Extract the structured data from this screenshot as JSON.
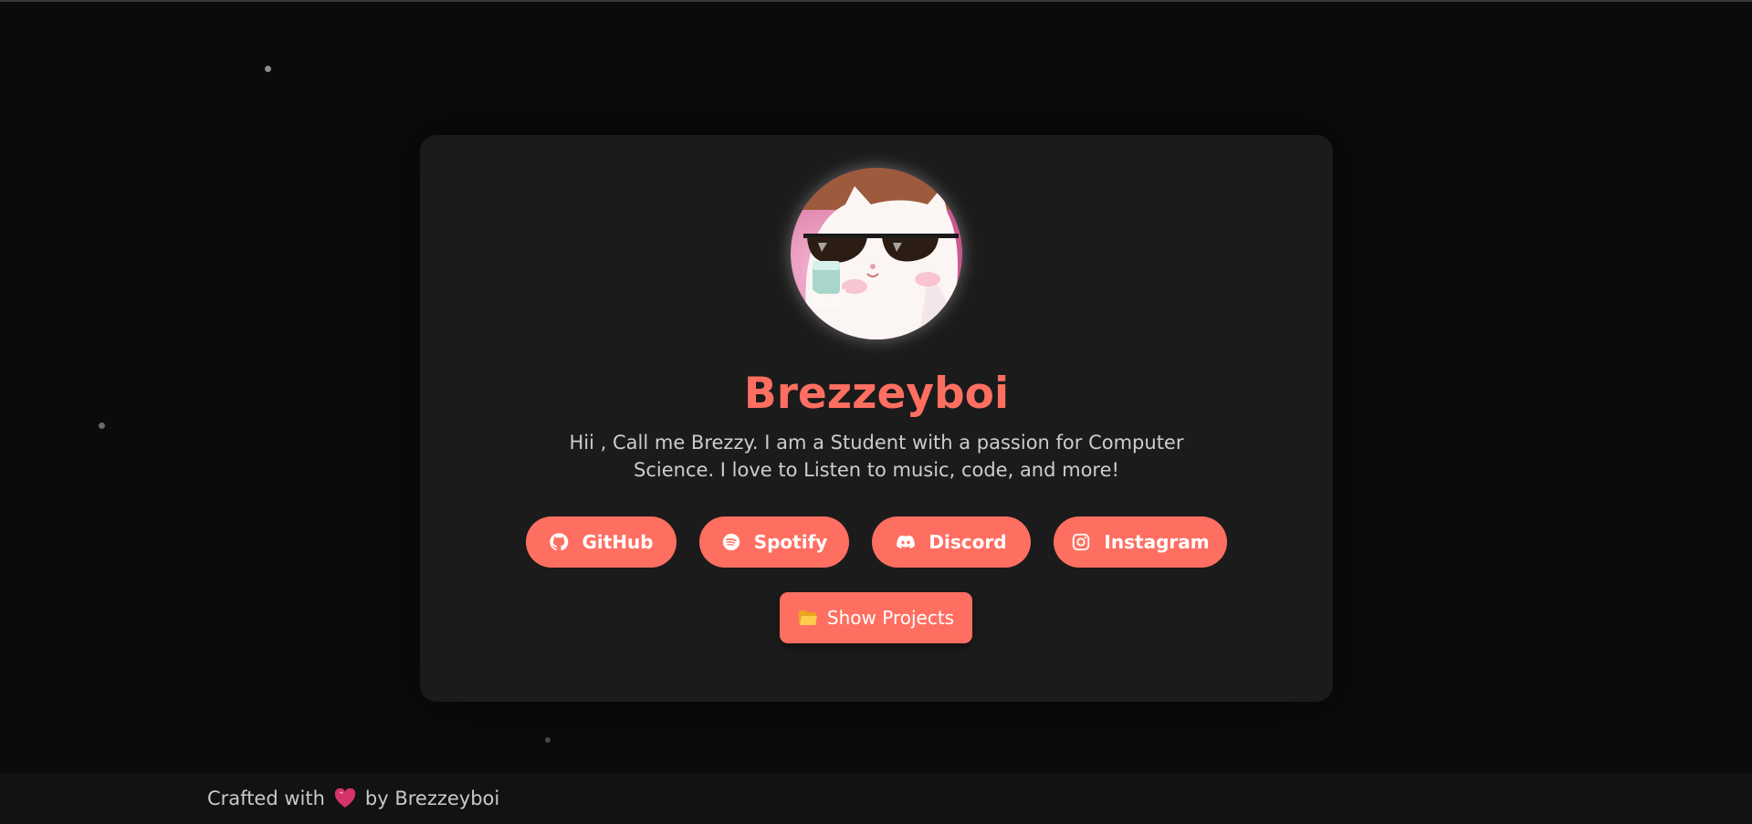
{
  "profile": {
    "name": "Brezzeyboi",
    "bio": "Hii , Call me Brezzy. I am a Student with a passion for Computer Science. I love to Listen to music, code, and more!",
    "avatar_alt": "White cat wearing sunglasses holding a drink"
  },
  "social_links": [
    {
      "label": "GitHub",
      "icon": "github-icon"
    },
    {
      "label": "Spotify",
      "icon": "spotify-icon"
    },
    {
      "label": "Discord",
      "icon": "discord-icon"
    },
    {
      "label": "Instagram",
      "icon": "instagram-icon"
    }
  ],
  "projects_button": {
    "label": "Show Projects",
    "icon": "folder-icon"
  },
  "footer": {
    "prefix": "Crafted with",
    "suffix": "by Brezzeyboi",
    "icon": "heart-icon"
  },
  "colors": {
    "accent": "#ff6f61",
    "background": "#0b0b0b",
    "card": "#1b1b1b",
    "footer": "#121212"
  }
}
